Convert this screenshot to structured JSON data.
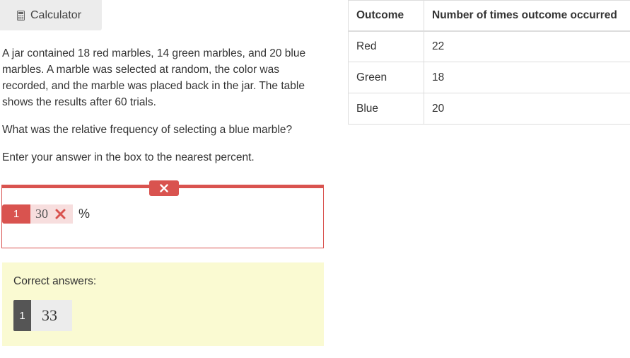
{
  "toolbar": {
    "calculator_label": "Calculator",
    "calculator_icon": "calculator-icon"
  },
  "question": {
    "paragraph1": "A jar contained 18 red marbles, 14 green marbles, and 20 blue marbles. A marble was selected at random, the color was recorded, and the marble was placed back in the jar. The table shows the results after 60 trials.",
    "paragraph2": "What was the relative frequency of selecting a blue marble?",
    "paragraph3": "Enter your answer in the box to the nearest percent."
  },
  "response": {
    "status_icon": "close-icon",
    "number": "1",
    "value": "30",
    "wrong_icon": "close-icon",
    "unit": "%"
  },
  "correct": {
    "title": "Correct answers:",
    "number": "1",
    "value": "33"
  },
  "table": {
    "headers": [
      "Outcome",
      "Number of times outcome occurred"
    ],
    "rows": [
      [
        "Red",
        "22"
      ],
      [
        "Green",
        "18"
      ],
      [
        "Blue",
        "20"
      ]
    ]
  },
  "colors": {
    "error": "#d9534f",
    "error_light": "#f7dede",
    "correct_bg": "#fafad2",
    "correct_badge": "#555555"
  }
}
